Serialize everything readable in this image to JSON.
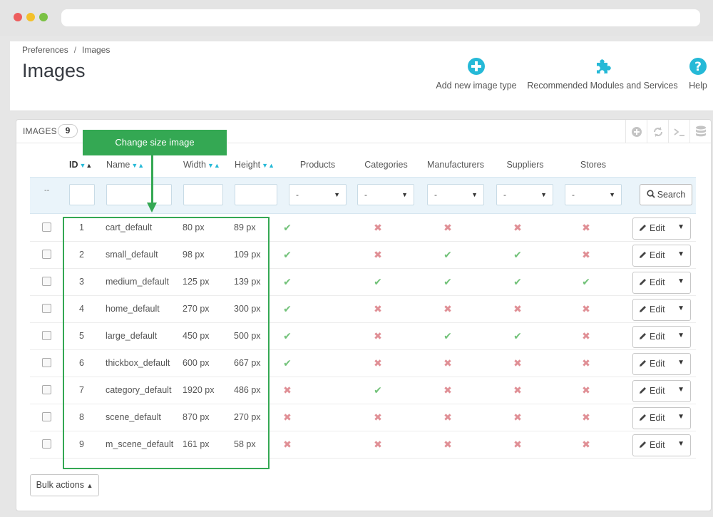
{
  "breadcrumb": {
    "parent": "Preferences",
    "separator": "/",
    "current": "Images"
  },
  "page_title": "Images",
  "toolbar": {
    "add_label": "Add new image type",
    "modules_label": "Recommended Modules and Services",
    "help_label": "Help",
    "icon_color": "#25b9d7"
  },
  "panel": {
    "title": "IMAGES",
    "count": "9"
  },
  "callout": {
    "text": "Change size image",
    "color": "#34a853"
  },
  "columns": {
    "id": "ID",
    "name": "Name",
    "width": "Width",
    "height": "Height",
    "products": "Products",
    "categories": "Categories",
    "manufacturers": "Manufacturers",
    "suppliers": "Suppliers",
    "stores": "Stores"
  },
  "filter": {
    "dash": "--",
    "select_value": "-",
    "search_label": "Search"
  },
  "rows": [
    {
      "id": "1",
      "name": "cart_default",
      "width": "80 px",
      "height": "89 px",
      "products": true,
      "categories": false,
      "manufacturers": false,
      "suppliers": false,
      "stores": false
    },
    {
      "id": "2",
      "name": "small_default",
      "width": "98 px",
      "height": "109 px",
      "products": true,
      "categories": false,
      "manufacturers": true,
      "suppliers": true,
      "stores": false
    },
    {
      "id": "3",
      "name": "medium_default",
      "width": "125 px",
      "height": "139 px",
      "products": true,
      "categories": true,
      "manufacturers": true,
      "suppliers": true,
      "stores": true
    },
    {
      "id": "4",
      "name": "home_default",
      "width": "270 px",
      "height": "300 px",
      "products": true,
      "categories": false,
      "manufacturers": false,
      "suppliers": false,
      "stores": false
    },
    {
      "id": "5",
      "name": "large_default",
      "width": "450 px",
      "height": "500 px",
      "products": true,
      "categories": false,
      "manufacturers": true,
      "suppliers": true,
      "stores": false
    },
    {
      "id": "6",
      "name": "thickbox_default",
      "width": "600 px",
      "height": "667 px",
      "products": true,
      "categories": false,
      "manufacturers": false,
      "suppliers": false,
      "stores": false
    },
    {
      "id": "7",
      "name": "category_default",
      "width": "1920 px",
      "height": "486 px",
      "products": false,
      "categories": true,
      "manufacturers": false,
      "suppliers": false,
      "stores": false
    },
    {
      "id": "8",
      "name": "scene_default",
      "width": "870 px",
      "height": "270 px",
      "products": false,
      "categories": false,
      "manufacturers": false,
      "suppliers": false,
      "stores": false
    },
    {
      "id": "9",
      "name": "m_scene_default",
      "width": "161 px",
      "height": "58 px",
      "products": false,
      "categories": false,
      "manufacturers": false,
      "suppliers": false,
      "stores": false
    }
  ],
  "row_actions": {
    "edit_label": "Edit"
  },
  "bulk_label": "Bulk actions",
  "colors": {
    "yes": "#72c279",
    "no": "#e08f95",
    "accent": "#25b9d7"
  }
}
